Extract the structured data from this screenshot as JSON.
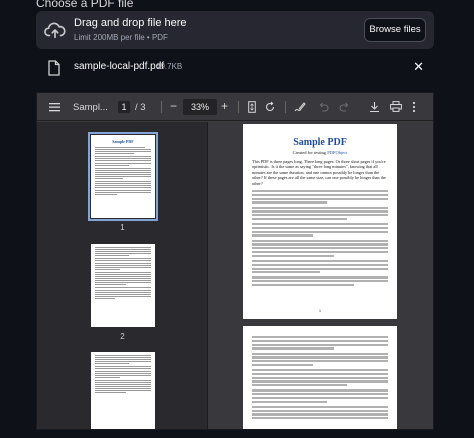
{
  "uploader": {
    "label": "Choose a PDF file",
    "drop_title": "Drag and drop file here",
    "drop_subtitle": "Limit 200MB per file • PDF",
    "browse_label": "Browse files"
  },
  "file": {
    "name": "sample-local-pdf.pdf",
    "size": "49.7KB"
  },
  "viewer": {
    "doc_title": "Sampl...",
    "current_page": "1",
    "page_total": "/ 3",
    "zoom": "33%",
    "thumbnails": [
      {
        "label": "1"
      },
      {
        "label": "2"
      }
    ],
    "page1": {
      "title": "Sample PDF",
      "subtitle_prefix": "Created for testing ",
      "subtitle_link": "PDFObject",
      "intro": "This PDF is three pages long. Three long pages. Or three short pages if you're optimistic. Is it the same as saying \"three long minutes\", knowing that all minutes are the same duration, and one cannot possibly be longer than the other? If these pages are all the same size, can one possibly be longer than the other?",
      "page_number": "1"
    }
  }
}
